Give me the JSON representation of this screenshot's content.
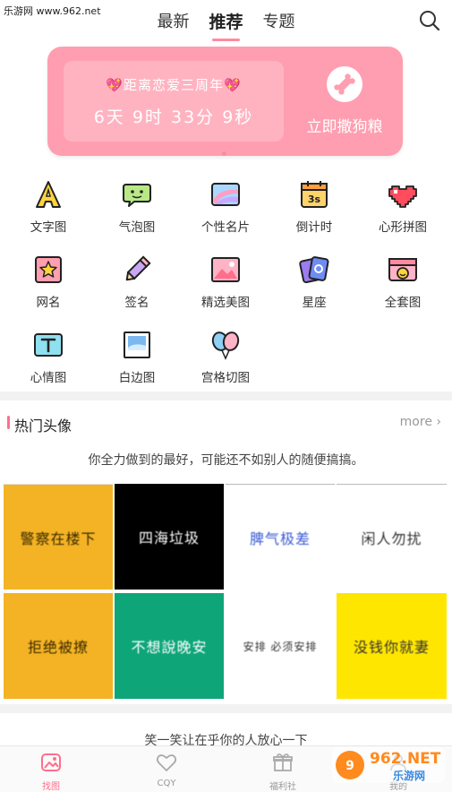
{
  "watermark": {
    "site": "乐游网 www.962.net",
    "logo": "962.NET 乐游网"
  },
  "header": {
    "tabs": [
      {
        "label": "最新",
        "active": false
      },
      {
        "label": "推荐",
        "active": true
      },
      {
        "label": "专题",
        "active": false
      }
    ],
    "search_icon": "search-icon"
  },
  "banner": {
    "title": "💖距离恋爱三周年💖",
    "countdown": "6天 9时 33分 9秒",
    "action": "立即撒狗粮",
    "icon": "bone-icon",
    "color": "#ff9eb0"
  },
  "grid": [
    {
      "label": "文字图",
      "icon": "letter-a-icon"
    },
    {
      "label": "气泡图",
      "icon": "bubble-icon"
    },
    {
      "label": "个性名片",
      "icon": "card-icon"
    },
    {
      "label": "倒计时",
      "icon": "calendar-icon"
    },
    {
      "label": "心形拼图",
      "icon": "pixel-heart-icon"
    },
    {
      "label": "网名",
      "icon": "star-flag-icon"
    },
    {
      "label": "签名",
      "icon": "pencil-icon"
    },
    {
      "label": "精选美图",
      "icon": "picture-icon"
    },
    {
      "label": "星座",
      "icon": "zodiac-card-icon"
    },
    {
      "label": "全套图",
      "icon": "avatar-set-icon"
    },
    {
      "label": "心情图",
      "icon": "text-t-icon"
    },
    {
      "label": "白边图",
      "icon": "frame-icon"
    },
    {
      "label": "宫格切图",
      "icon": "balloon-icon"
    }
  ],
  "hot": {
    "title": "热门头像",
    "more": "more ›",
    "quote": "你全力做到的最好，可能还不如别人的随便搞搞。",
    "avatars": [
      {
        "text": "警察在楼下",
        "bg": "#f4b324",
        "fg": "#3a2a00"
      },
      {
        "text": "四海垃圾",
        "bg": "#000000",
        "fg": "#ffffff"
      },
      {
        "text": "脾气极差",
        "bg": "#ffffff",
        "fg": "#3b5bd6"
      },
      {
        "text": "闲人勿扰",
        "bg": "#ffffff",
        "fg": "#333333"
      },
      {
        "text": "拒绝被撩",
        "bg": "#f4b324",
        "fg": "#3a2a00"
      },
      {
        "text": "不想說晚安",
        "bg": "#0ea679",
        "fg": "#ffffff"
      },
      {
        "text": "安排  必须安排",
        "bg": "#ffffff",
        "fg": "#333333"
      },
      {
        "text": "没钱你就妻",
        "bg": "#ffe600",
        "fg": "#333333"
      }
    ],
    "quote2": "笑一笑让在乎你的人放心一下"
  },
  "bottom_nav": [
    {
      "label": "找图",
      "icon": "image-icon",
      "active": true
    },
    {
      "label": "CQY",
      "icon": "heart-icon",
      "active": false
    },
    {
      "label": "福利社",
      "icon": "gift-icon",
      "active": false
    },
    {
      "label": "我的",
      "icon": "user-icon",
      "active": false
    }
  ],
  "colors": {
    "accent": "#ff6f8c",
    "banner": "#ff9eb0",
    "divider": "#f2f2f2"
  }
}
